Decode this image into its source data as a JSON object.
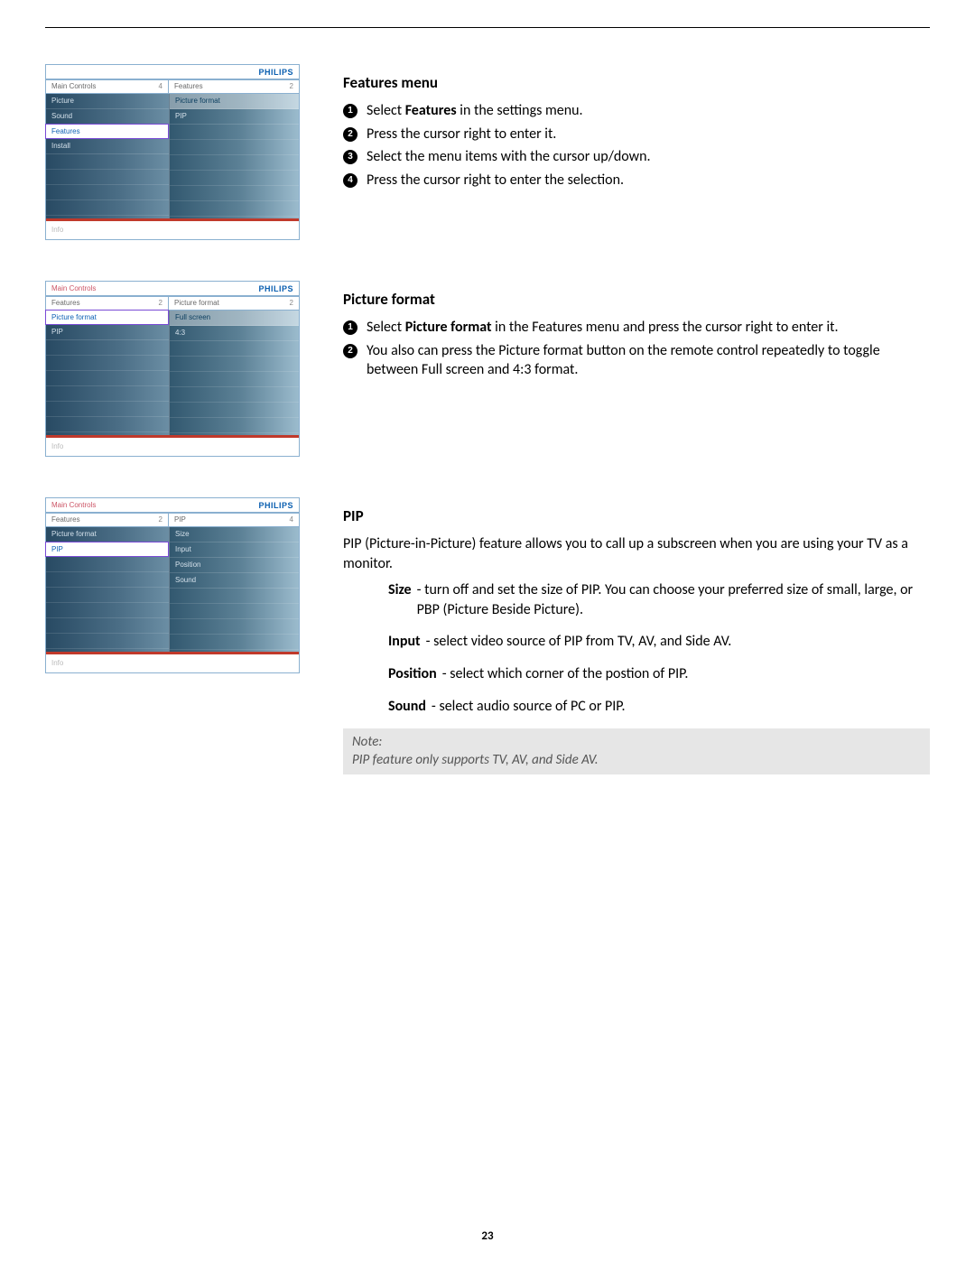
{
  "page_number": "23",
  "brand": "PHILIPS",
  "osd_info_label": "Info",
  "osd1": {
    "left_title": "Main Controls",
    "left_num": "4",
    "right_title": "Features",
    "right_num": "2",
    "left_items": [
      "Picture",
      "Sound",
      "Features",
      "Install"
    ],
    "left_selected_index": 2,
    "right_items": [
      "Picture format",
      "PIP"
    ],
    "right_hl_index": 0
  },
  "osd2": {
    "crumb": "Main Controls",
    "left_title": "Features",
    "left_num": "2",
    "right_title": "Picture format",
    "right_num": "2",
    "left_items": [
      "Picture format",
      "PIP"
    ],
    "left_selected_index": 0,
    "right_items": [
      "Full screen",
      "4:3"
    ],
    "right_hl_index": 0
  },
  "osd3": {
    "crumb": "Main Controls",
    "left_title": "Features",
    "left_num": "2",
    "right_title": "PIP",
    "right_num": "4",
    "left_items": [
      "Picture format",
      "PIP"
    ],
    "left_selected_index": 1,
    "right_items": [
      "Size",
      "Input",
      "Position",
      "Sound"
    ],
    "right_hl_index": -1
  },
  "sec1": {
    "title": "Features menu",
    "steps": [
      {
        "pre": "Select ",
        "bold": "Features",
        "post": " in the settings menu."
      },
      {
        "pre": "Press the cursor right to enter it."
      },
      {
        "pre": "Select the menu items with the cursor up/down."
      },
      {
        "pre": "Press the cursor right to enter the selection."
      }
    ]
  },
  "sec2": {
    "title": "Picture format",
    "steps": [
      {
        "pre": "Select ",
        "bold": "Picture format",
        "post": " in the Features menu and press the cursor right to enter it."
      },
      {
        "pre": "You also can press the Picture format button on the remote control repeatedly to toggle between Full screen and 4:3 format."
      }
    ]
  },
  "sec3": {
    "title": "PIP",
    "intro": "PIP (Picture-in-Picture) feature allows you to call up a subscreen when you are using your TV as a monitor.",
    "defs": [
      {
        "label": "Size",
        "text": " - turn off and set the size of PIP.  You can choose your preferred size of small, large, or PBP (Picture Beside Picture)."
      },
      {
        "label": "Input",
        "text": " - select video source of PIP from TV, AV, and Side AV."
      },
      {
        "label": "Position",
        "text": " - select which corner of the postion of PIP."
      },
      {
        "label": "Sound",
        "text": " - select audio source of PC or PIP."
      }
    ],
    "note_title": "Note:",
    "note_body": "PIP feature only supports TV, AV, and Side AV."
  }
}
